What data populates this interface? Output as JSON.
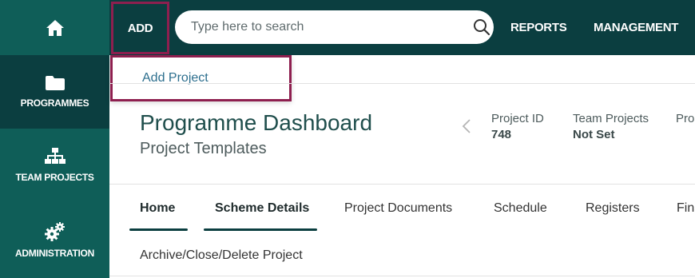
{
  "sidebar": {
    "items": [
      {
        "label": "",
        "icon": "home-icon"
      },
      {
        "label": "PROGRAMMES",
        "icon": "folder-icon"
      },
      {
        "label": "TEAM PROJECTS",
        "icon": "org-chart-icon"
      },
      {
        "label": "ADMINISTRATION",
        "icon": "gears-icon"
      }
    ]
  },
  "topbar": {
    "add_label": "ADD",
    "search_placeholder": "Type here to search",
    "reports_label": "REPORTS",
    "management_label": "MANAGEMENT"
  },
  "dropdown": {
    "items": [
      {
        "label": "Add Project"
      }
    ]
  },
  "page": {
    "title": "Programme Dashboard",
    "subtitle": "Project Templates"
  },
  "meta": [
    {
      "label": "Project ID",
      "value": "748"
    },
    {
      "label": "Team Projects",
      "value": "Not Set"
    },
    {
      "label": "Pro",
      "value": ""
    }
  ],
  "tabs": [
    {
      "label": "Home",
      "active": true
    },
    {
      "label": "Scheme Details",
      "active": true
    },
    {
      "label": "Project Documents",
      "active": false
    },
    {
      "label": "Schedule",
      "active": false
    },
    {
      "label": "Registers",
      "active": false
    },
    {
      "label": "Fina",
      "active": false
    }
  ],
  "tabs_row2": [
    {
      "label": "Archive/Close/Delete Project"
    }
  ],
  "colors": {
    "sidebar": "#0f5e58",
    "sidebar_active": "#0b3e40",
    "topbar": "#0b3e40",
    "highlight_border": "#8e1f4f",
    "link": "#2d6f8e"
  }
}
